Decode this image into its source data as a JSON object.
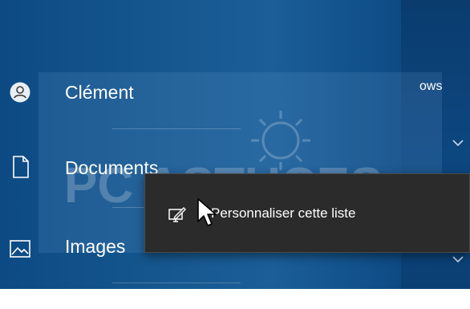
{
  "nav": {
    "items": [
      {
        "label": "Clément",
        "icon": "user-icon"
      },
      {
        "label": "Documents",
        "icon": "document-icon"
      },
      {
        "label": "Images",
        "icon": "image-icon"
      }
    ]
  },
  "header": {
    "partial_title": "ows"
  },
  "context_menu": {
    "items": [
      {
        "label": "Personnaliser cette liste",
        "icon": "customize-icon"
      }
    ]
  },
  "watermark": {
    "text": "PC ASTUCES"
  },
  "colors": {
    "panel_blue": "#16578f",
    "menu_bg": "#2b2b2b",
    "text": "#ffffff"
  }
}
